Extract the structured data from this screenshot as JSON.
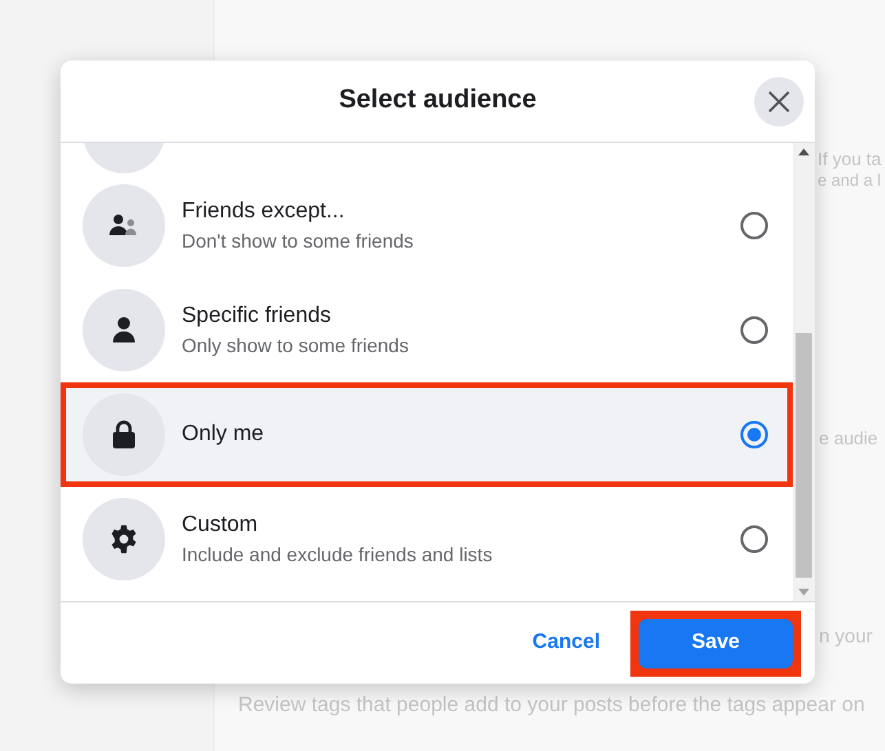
{
  "background": {
    "texts": [
      "If you ta",
      "e and a l",
      "e audie",
      "n your",
      "Review tags that people add to your posts before the tags appear on"
    ]
  },
  "dialog": {
    "title": "Select audience",
    "options": [
      {
        "kind": "friends-except",
        "label": "Friends except...",
        "description": "Don't show to some friends",
        "selected": false,
        "highlighted": false
      },
      {
        "kind": "person",
        "label": "Specific friends",
        "description": "Only show to some friends",
        "selected": false,
        "highlighted": false
      },
      {
        "kind": "lock",
        "label": "Only me",
        "selected": true,
        "highlighted": true
      },
      {
        "kind": "gear",
        "label": "Custom",
        "description": "Include and exclude friends and lists",
        "selected": false,
        "highlighted": false
      }
    ],
    "cancel": "Cancel",
    "save": {
      "label": "Save",
      "highlighted": true
    }
  }
}
